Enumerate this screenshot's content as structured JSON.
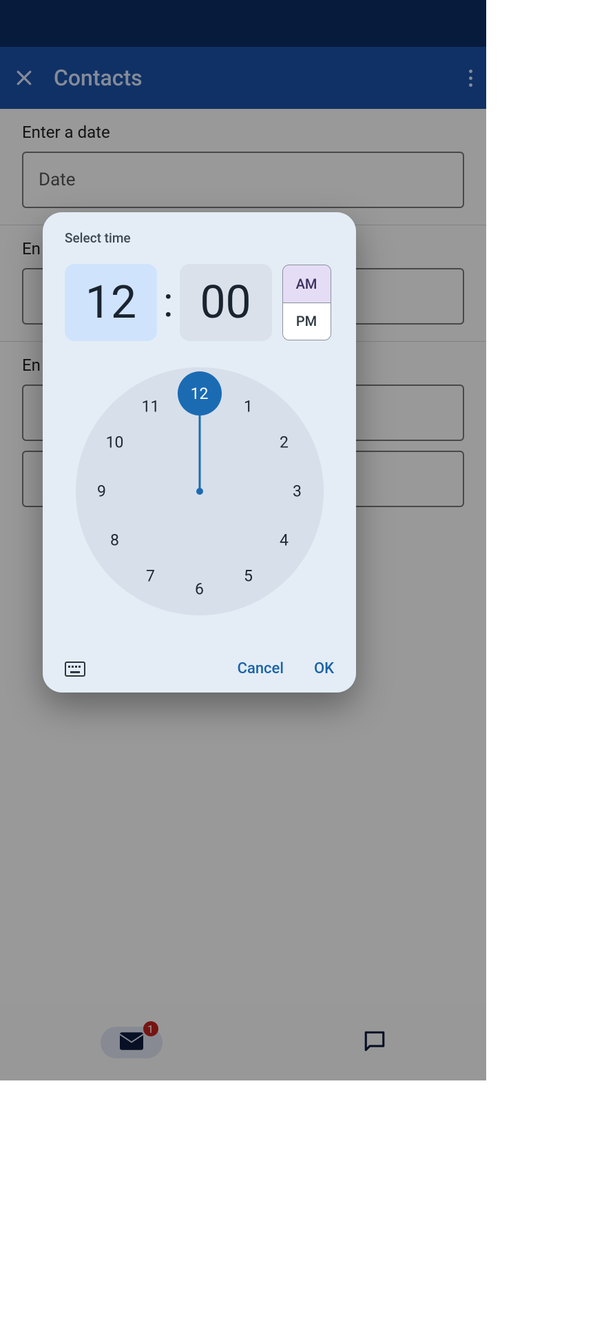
{
  "app_bar": {
    "title": "Contacts"
  },
  "page": {
    "date_label": "Enter a date",
    "date_placeholder": "Date",
    "section2_label_prefix": "En",
    "section3_label_prefix": "En"
  },
  "nav": {
    "badge_count": "1"
  },
  "dialog": {
    "title": "Select time",
    "hour": "12",
    "minute": "00",
    "am": "AM",
    "pm": "PM",
    "hours": {
      "h1": "1",
      "h2": "2",
      "h3": "3",
      "h4": "4",
      "h5": "5",
      "h6": "6",
      "h7": "7",
      "h8": "8",
      "h9": "9",
      "h10": "10",
      "h11": "11",
      "h12": "12"
    },
    "cancel": "Cancel",
    "ok": "OK"
  }
}
